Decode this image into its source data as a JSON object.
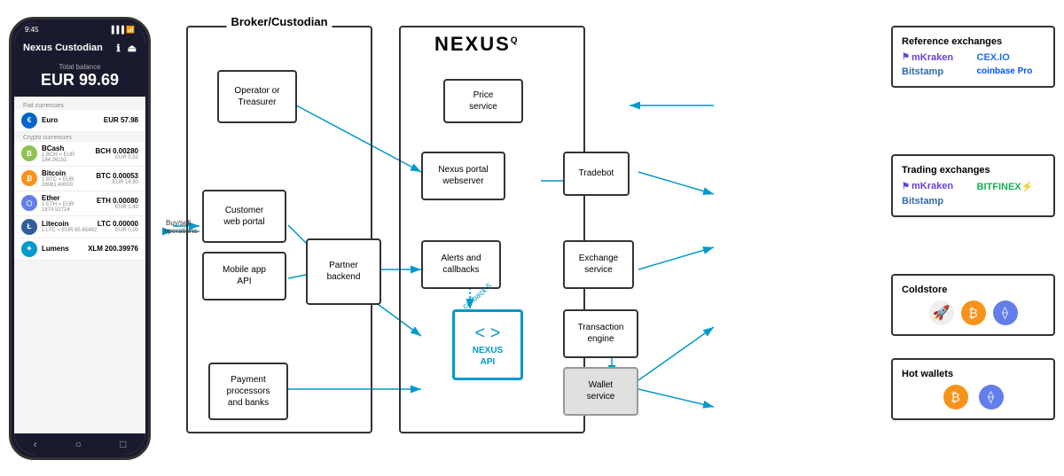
{
  "phone": {
    "time": "9:45",
    "title": "Nexus Custodian",
    "total_balance_label": "Total balance",
    "total_balance": "EUR 99.69",
    "fiat_section": "Fiat currencies",
    "crypto_section": "Crypto currencies",
    "currencies": [
      {
        "name": "Euro",
        "icon": "€",
        "icon_color": "#0066cc",
        "amount": "EUR 57.98",
        "eur": ""
      },
      {
        "name": "BCash",
        "sub": "1 BCH = EUR 184.26151",
        "icon": "B",
        "icon_color": "#8dc351",
        "amount": "BCH 0.00280",
        "eur": "EUR 0.52"
      },
      {
        "name": "Bitcoin",
        "sub": "1 BTC = EUR 28061.40000",
        "icon": "₿",
        "icon_color": "#f7931a",
        "amount": "BTC 0.00053",
        "eur": "EUR 14.90"
      },
      {
        "name": "Ether",
        "sub": "1 ETH = EUR 1874.52724",
        "icon": "⬡",
        "icon_color": "#627eea",
        "amount": "ETH 0.00080",
        "eur": "EUR 1.49"
      },
      {
        "name": "Litecoin",
        "sub": "1 LTC = EUR 65.65492",
        "icon": "Ł",
        "icon_color": "#345d9d",
        "amount": "LTC 0.00000",
        "eur": "EUR 0.00"
      },
      {
        "name": "Lumens",
        "sub": "",
        "icon": "✦",
        "icon_color": "#0099cc",
        "amount": "XLM 200.39976",
        "eur": ""
      }
    ]
  },
  "broker": {
    "title": "Broker/Custodian",
    "boxes": [
      {
        "id": "operator",
        "label": "Operator\nor Treasurer"
      },
      {
        "id": "customer-web",
        "label": "Customer\nweb portal"
      },
      {
        "id": "mobile-api",
        "label": "Mobile app\nAPI"
      },
      {
        "id": "partner-backend",
        "label": "Partner\nbackend"
      },
      {
        "id": "payment",
        "label": "Payment\nprocessors\nand banks"
      }
    ],
    "buysell": "Buy/sell\noperations"
  },
  "nexus": {
    "title": "NEXUS",
    "boxes": [
      {
        "id": "price-service",
        "label": "Price\nservice"
      },
      {
        "id": "portal-webserver",
        "label": "Nexus portal\nwebserver"
      },
      {
        "id": "tradebot",
        "label": "Tradebot"
      },
      {
        "id": "alerts-callbacks",
        "label": "Alerts and\ncallbacks"
      },
      {
        "id": "exchange-service",
        "label": "Exchange\nservice"
      },
      {
        "id": "nexus-api",
        "label": "NEXUS\nAPI"
      },
      {
        "id": "transaction-engine",
        "label": "Transaction\nengine"
      },
      {
        "id": "wallet-service",
        "label": "Wallet\nservice"
      }
    ],
    "callback_label": "callback 5"
  },
  "reference_exchanges": {
    "title": "Reference exchanges",
    "logos": [
      {
        "name": "Kraken",
        "style": "kraken"
      },
      {
        "name": "CEX.IO",
        "style": "cex"
      },
      {
        "name": "Bitstamp",
        "style": "bitstamp"
      },
      {
        "name": "coinbase Pro",
        "style": "coinbase"
      }
    ]
  },
  "trading_exchanges": {
    "title": "Trading exchanges",
    "logos": [
      {
        "name": "Kraken",
        "style": "kraken"
      },
      {
        "name": "BITFINEX",
        "style": "bitfinex"
      },
      {
        "name": "Bitstamp",
        "style": "bitstamp"
      }
    ]
  },
  "coldstore": {
    "title": "Coldstore"
  },
  "hot_wallets": {
    "title": "Hot wallets"
  }
}
